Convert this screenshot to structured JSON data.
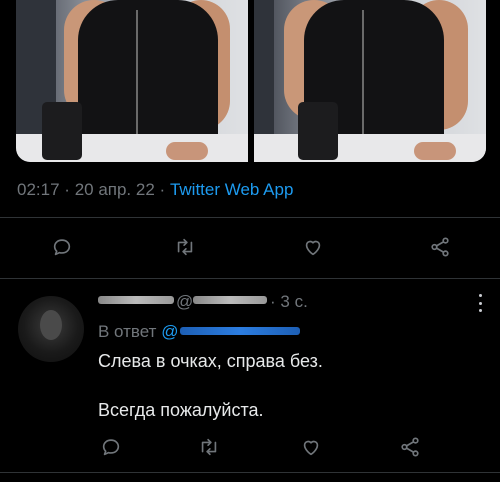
{
  "tweet": {
    "time": "02:17",
    "separator1": "·",
    "date": "20 апр. 22",
    "separator2": "·",
    "source": "Twitter Web App"
  },
  "actions": {
    "reply_icon": "reply-icon",
    "retweet_icon": "retweet-icon",
    "like_icon": "heart-icon",
    "share_icon": "share-icon"
  },
  "reply": {
    "at_symbol": "@",
    "separator": "·",
    "time_ago": "3 с.",
    "reply_to_label": "В ответ",
    "reply_to_at": "@",
    "text_line1": "Слева в очках, справа без.",
    "text_line2": "Всегда пожалуйста."
  },
  "colors": {
    "background": "#000000",
    "muted": "#71767b",
    "link": "#1d9bf0",
    "text": "#e7e9ea"
  }
}
